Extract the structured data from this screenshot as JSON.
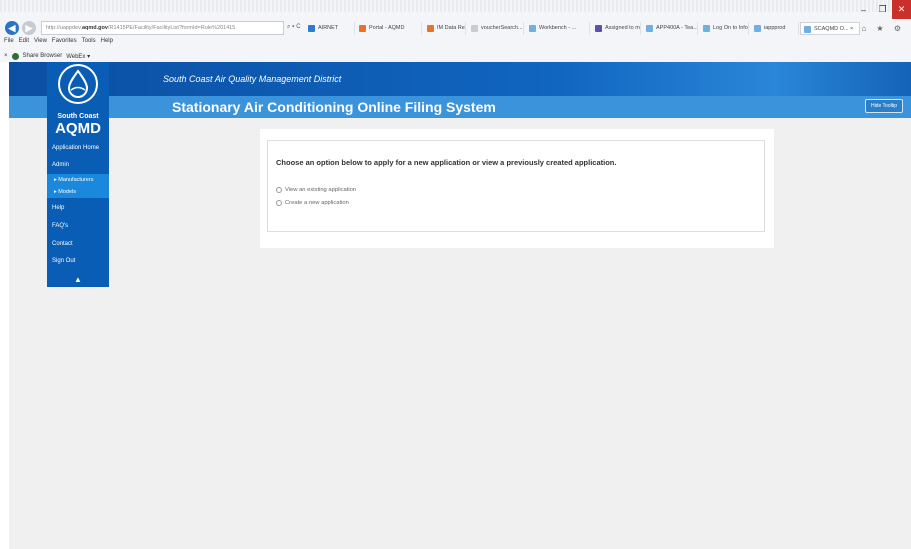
{
  "browser": {
    "address": {
      "prefix": "http://uappdev.",
      "host": "aqmd.gov",
      "path": "/R1415PE/Facility/FacilityList?formId=Rule%201415"
    },
    "address_tools": "⌕ ▾ C",
    "tabs": [
      {
        "label": "AIRNET",
        "color": "#2f7bd1"
      },
      {
        "label": "Portal - AQMD",
        "color": "#e4742a"
      },
      {
        "label": "IM Data Reque...",
        "color": "#e4742a"
      },
      {
        "label": "voucherSearch...",
        "color": "#cccccc"
      },
      {
        "label": "Workbench - ...",
        "color": "#6fb0e0"
      },
      {
        "label": "Assigned to m...",
        "color": "#5b4fb3"
      },
      {
        "label": "APP400A - Tea...",
        "color": "#6fb0e0"
      },
      {
        "label": "Log On to Info...",
        "color": "#6fb0e0"
      },
      {
        "label": "iappprod",
        "color": "#6fb0e0"
      },
      {
        "label": "SCAQMD O... ×",
        "color": "#6fb0e0"
      }
    ],
    "window_buttons": {
      "minimize": "–",
      "restore": "❐",
      "close": "✕"
    },
    "toolbar_icons": "⌂ ★ ⚙",
    "menu": [
      "File",
      "Edit",
      "View",
      "Favorites",
      "Tools",
      "Help"
    ],
    "favorites_bar": {
      "close": "×",
      "share": "Share Browser",
      "webex": "WebEx ▾"
    }
  },
  "header": {
    "district": "South Coast Air Quality Management District",
    "title": "Stationary Air Conditioning Online Filing System",
    "hide_tooltip": "Hide Tooltip"
  },
  "sidebar": {
    "logo_line1": "South Coast",
    "logo_line2": "AQMD",
    "items": [
      {
        "label": "Application Home"
      },
      {
        "label": "Admin"
      },
      {
        "label": "Help"
      },
      {
        "label": "FAQ's"
      },
      {
        "label": "Contact"
      },
      {
        "label": "Sign Out"
      }
    ],
    "admin_sub": [
      "▸ Manufacturers",
      "▸ Models"
    ],
    "collapse": "▲"
  },
  "main": {
    "prompt": "Choose an option below to apply for a new application or view a previously created application.",
    "options": [
      "View an existing application",
      "Create a new application"
    ]
  }
}
